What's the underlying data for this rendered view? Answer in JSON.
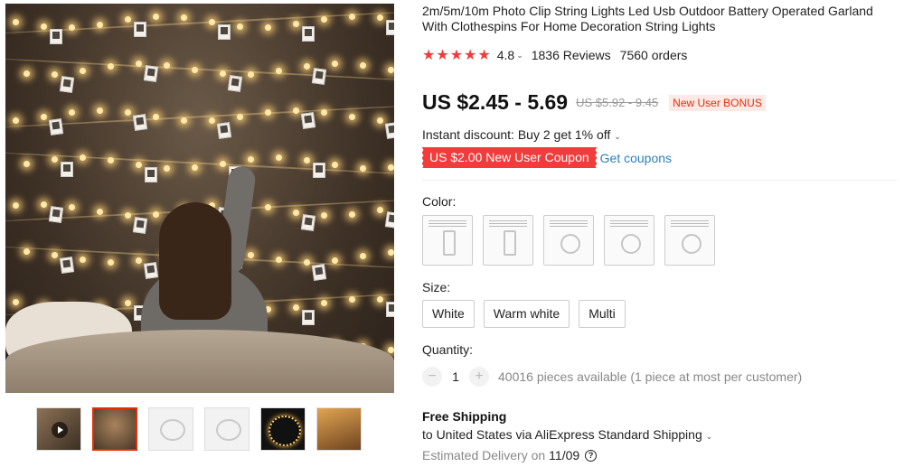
{
  "product": {
    "title": "2m/5m/10m Photo Clip String Lights Led Usb Outdoor Battery Operated Garland With Clothespins For Home Decoration String Lights",
    "rating": "4.8",
    "stars": "★★★★★",
    "reviews": "1836 Reviews",
    "orders": "7560 orders"
  },
  "price": {
    "current": "US $2.45 - 5.69",
    "original": "US $5.92 - 9.45",
    "bonus_badge": "New User BONUS"
  },
  "discount": {
    "text": "Instant discount: Buy 2 get 1% off"
  },
  "coupon": {
    "label": "US $2.00 New User Coupon",
    "link": "Get coupons"
  },
  "color": {
    "label": "Color:",
    "options": [
      "swatch-1",
      "swatch-2",
      "swatch-3",
      "swatch-4",
      "swatch-5"
    ]
  },
  "size": {
    "label": "Size:",
    "options": [
      "White",
      "Warm white",
      "Multi"
    ]
  },
  "quantity": {
    "label": "Quantity:",
    "minus": "−",
    "plus": "+",
    "value": "1",
    "available": "40016 pieces available (1 piece at most per customer)"
  },
  "shipping": {
    "title": "Free Shipping",
    "to": "to United States via AliExpress Standard Shipping",
    "delivery_label": "Estimated Delivery on",
    "delivery_date": "11/09",
    "help": "?"
  },
  "icons": {
    "chevron": "⌄",
    "play": "play-icon"
  },
  "colors": {
    "accent": "#f23b3b",
    "link": "#2d7fbf",
    "bonus_text": "#e62e04"
  }
}
